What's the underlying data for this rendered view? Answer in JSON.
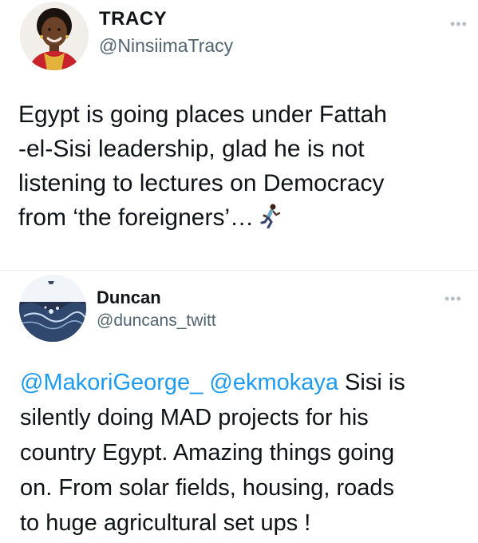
{
  "tweets": [
    {
      "name": "TRACY",
      "handle": "@NinsiimaTracy",
      "more_icon": "more-dots-icon",
      "lines": [
        "Egypt is going places under Fattah",
        "-el-Sisi leadership, glad he is not",
        "listening to lectures on Democracy",
        "from ‘the foreigners’…"
      ],
      "emoji": "running-woman-icon"
    },
    {
      "name": "Duncan",
      "handle": "@duncans_twitt",
      "more_icon": "more-dots-icon",
      "mentions": [
        "@MakoriGeorge_",
        "@ekmokaya"
      ],
      "first_line_rest": " Sisi is",
      "lines": [
        "silently doing MAD projects for his",
        "country Egypt. Amazing things going",
        "on. From solar fields, housing, roads",
        "to huge agricultural set ups !"
      ]
    }
  ],
  "colors": {
    "mention": "#1d9bf0",
    "handle": "#536471",
    "text": "#0f1419"
  }
}
